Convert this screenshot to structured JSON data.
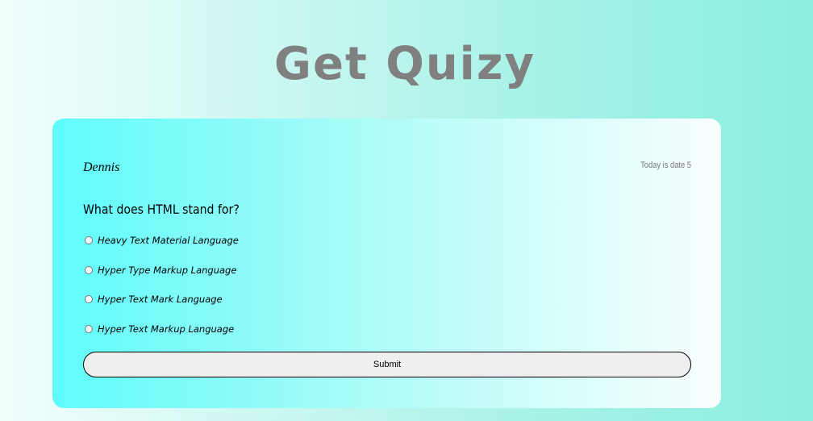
{
  "header": {
    "title": "Get Quizy"
  },
  "quiz": {
    "user_name": "Dennis",
    "date_text": "Today is date 5",
    "question": "What does HTML stand for?",
    "options": [
      {
        "label": "Heavy Text Material Language",
        "selected": false
      },
      {
        "label": "Hyper Type Markup Language",
        "selected": false
      },
      {
        "label": "Hyper Text Mark Language",
        "selected": false
      },
      {
        "label": "Hyper Text Markup Language",
        "selected": false
      }
    ],
    "submit_label": "Submit"
  },
  "colors": {
    "title": "#808080",
    "card_start": "#5efcfc",
    "card_end": "#f9fefe",
    "page_background_start": "#f3fffd",
    "page_background_end": "#8aeee0"
  }
}
